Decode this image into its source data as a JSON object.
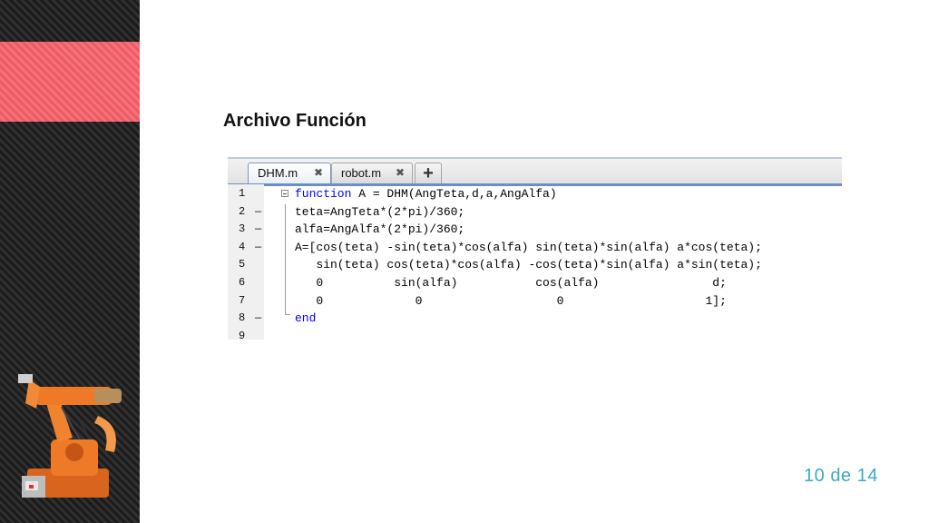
{
  "slide": {
    "title": "Archivo Función",
    "page_current": "10",
    "page_separator": "de",
    "page_total": "14"
  },
  "editor": {
    "tabs": [
      {
        "label": "DHM.m",
        "close_symbol": "✖",
        "active": true
      },
      {
        "label": "robot.m",
        "close_symbol": "✖",
        "active": false
      }
    ],
    "add_tab_symbol": "+",
    "lines": [
      {
        "number": "1",
        "dash": "",
        "keyword": "function",
        "text": " A = DHM(AngTeta,d,a,AngAlfa)"
      },
      {
        "number": "2",
        "dash": "—",
        "keyword": "",
        "text": "teta=AngTeta*(2*pi)/360;"
      },
      {
        "number": "3",
        "dash": "—",
        "keyword": "",
        "text": "alfa=AngAlfa*(2*pi)/360;"
      },
      {
        "number": "4",
        "dash": "—",
        "keyword": "",
        "text": "A=[cos(teta) -sin(teta)*cos(alfa) sin(teta)*sin(alfa) a*cos(teta);"
      },
      {
        "number": "5",
        "dash": "",
        "keyword": "",
        "text": "   sin(teta) cos(teta)*cos(alfa) -cos(teta)*sin(alfa) a*sin(teta);"
      },
      {
        "number": "6",
        "dash": "",
        "keyword": "",
        "text": "   0          sin(alfa)           cos(alfa)                d;"
      },
      {
        "number": "7",
        "dash": "",
        "keyword": "",
        "text": "   0             0                   0                    1];"
      },
      {
        "number": "8",
        "dash": "—",
        "keyword": "end",
        "text": ""
      },
      {
        "number": "9",
        "dash": "",
        "keyword": "",
        "text": ""
      }
    ]
  },
  "colors": {
    "keyword": "#0000ff",
    "accent_red": "#f0606a",
    "page_counter": "#3aa9c7"
  }
}
